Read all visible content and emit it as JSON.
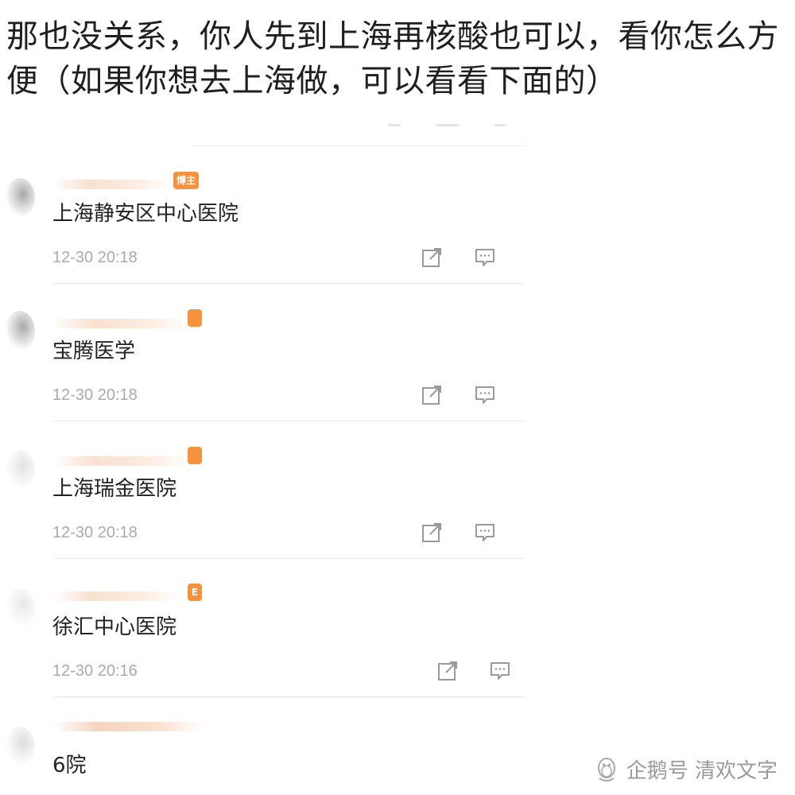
{
  "header": {
    "text": "那也没关系，你人先到上海再核酸也可以，看你怎么方便（如果你想去上海做，可以看看下面的）"
  },
  "comments": [
    {
      "text": "上海静安区中心医院",
      "time": "12-30 20:18",
      "badge": "博主"
    },
    {
      "text": "宝腾医学",
      "time": "12-30 20:18",
      "badge": ""
    },
    {
      "text": "上海瑞金医院",
      "time": "12-30 20:18",
      "badge": ""
    },
    {
      "text": "徐汇中心医院",
      "time": "12-30 20:16",
      "badge": "E"
    },
    {
      "text": "6院",
      "time": "",
      "badge": ""
    }
  ],
  "watermark": {
    "text": "企鹅号 清欢文字"
  },
  "colors": {
    "badge": "#f5923e",
    "text": "#222222",
    "time": "#aaaaaa",
    "icon": "#9a9a9a"
  },
  "icons": [
    "share-icon",
    "comment-icon",
    "penguin-icon"
  ]
}
